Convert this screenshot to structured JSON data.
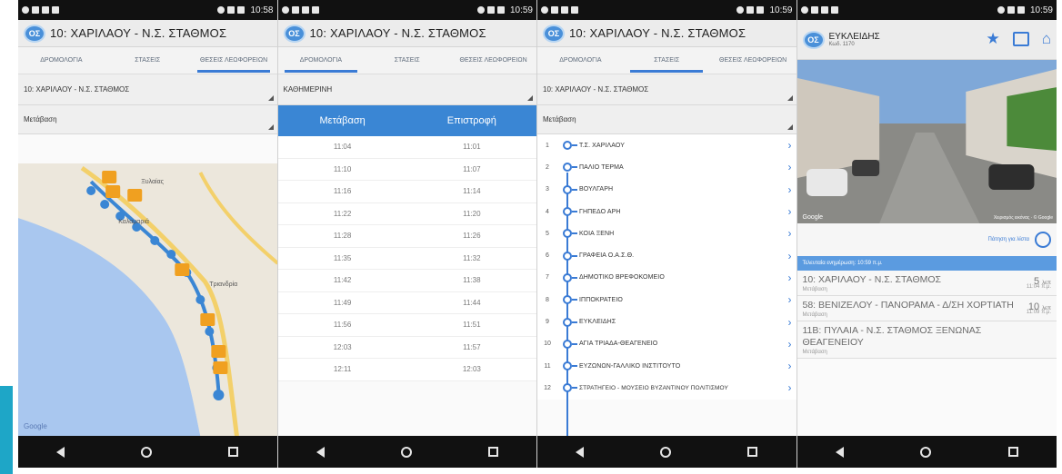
{
  "status_bar": {
    "time_1": "10:58",
    "time_2": "10:59",
    "time_3": "10:59",
    "time_4": "10:59"
  },
  "app": {
    "title": "10: ΧΑΡΙΛΑΟΥ - Ν.Σ. ΣΤΑΘΜΟΣ",
    "logo_text": "OΣ"
  },
  "tabs": [
    "ΔΡΟΜΟΛΟΓΙΑ",
    "ΣΤΑΣΕΙΣ",
    "ΘΕΣΕΙΣ ΛΕΩΦΟΡΕΙΩΝ"
  ],
  "screen1": {
    "route_select": "10: ΧΑΡΙΛΑΟΥ - Ν.Σ. ΣΤΑΘΜΟΣ",
    "direction_select": "Μετάβαση",
    "map_labels": [
      "Ξυλαίας",
      "Καλαμαριά",
      "Τριανδρία"
    ],
    "map_credit": "Google"
  },
  "screen2": {
    "day_select": "ΚΑΘΗΜΕΡΙΝΗ",
    "col_out": "Μετάβαση",
    "col_back": "Επιστροφή",
    "rows": [
      [
        "11:04",
        "11:01"
      ],
      [
        "11:10",
        "11:07"
      ],
      [
        "11:16",
        "11:14"
      ],
      [
        "11:22",
        "11:20"
      ],
      [
        "11:28",
        "11:26"
      ],
      [
        "11:35",
        "11:32"
      ],
      [
        "11:42",
        "11:38"
      ],
      [
        "11:49",
        "11:44"
      ],
      [
        "11:56",
        "11:51"
      ],
      [
        "12:03",
        "11:57"
      ],
      [
        "12:11",
        "12:03"
      ]
    ]
  },
  "screen3": {
    "route_select": "10: ΧΑΡΙΛΑΟΥ - Ν.Σ. ΣΤΑΘΜΟΣ",
    "direction_select": "Μετάβαση",
    "stops": [
      {
        "n": "1",
        "name": "Τ.Σ. ΧΑΡΙΛΑΟΥ"
      },
      {
        "n": "2",
        "name": "ΠΑΛΙΟ ΤΕΡΜΑ"
      },
      {
        "n": "3",
        "name": "ΒΟΥΛΓΑΡΗ"
      },
      {
        "n": "4",
        "name": "ΓΗΠΕΔΟ ΑΡΗ"
      },
      {
        "n": "5",
        "name": "ΚΟΙΑ ΞΕΝΗ"
      },
      {
        "n": "6",
        "name": "ΓΡΑΦΕΙΑ Ο.Α.Σ.Θ."
      },
      {
        "n": "7",
        "name": "ΔΗΜΟΤΙΚΟ ΒΡΕΦΟΚΟΜΕΙΟ"
      },
      {
        "n": "8",
        "name": "ΙΠΠΟΚΡΑΤΕΙΟ"
      },
      {
        "n": "9",
        "name": "ΕΥΚΛΕΙΔΗΣ"
      },
      {
        "n": "10",
        "name": "ΑΓΙΑ ΤΡΙΑΔΑ-ΘΕΑΓΕΝΕΙΟ"
      },
      {
        "n": "11",
        "name": "ΕΥΖΩΝΩΝ-ΓΑΛΛΙΚΟ ΙΝΣΤΙΤΟΥΤΟ"
      },
      {
        "n": "12",
        "name": "ΣΤΡΑΤΗΓΕΙΟ - ΜΟΥΣΕΙΟ ΒΥΖΑΝΤΙΝΟΥ ΠΟΛΙΤΙΣΜΟΥ"
      }
    ]
  },
  "screen4": {
    "stop_name": "ΕΥΚΛΕΙΔΗΣ",
    "stop_code": "Κωδ. 1170",
    "sv_brand": "Google",
    "sv_credit": "Χειρισμός εικόνας · © Google",
    "more_link": "Πάτηση για λίστα",
    "arrivals_bar": "Τελευταία ενημέρωση: 10:59 π.μ.",
    "arrivals": [
      {
        "route": "10: ΧΑΡΙΛΑΟΥ - Ν.Σ. ΣΤΑΘΜΟΣ",
        "dir": "Μετάβαση",
        "min": "5",
        "unit": "λεπ",
        "time": "11:04 π.μ."
      },
      {
        "route": "58: ΒΕΝΙΖΕΛΟΥ - ΠΑΝΟΡΑΜΑ - Δ/ΣΗ ΧΟΡΤΙΑΤΗ",
        "dir": "Μετάβαση",
        "min": "10",
        "unit": "λεπ",
        "time": "11:09 π.μ."
      },
      {
        "route": "11Β: ΠΥΛΑΙΑ - Ν.Σ. ΣΤΑΘΜΟΣ ΞΕΝΩΝΑΣ ΘΕΑΓΕΝΕΙΟΥ",
        "dir": "Μετάβαση",
        "min": "",
        "unit": "",
        "time": ""
      }
    ]
  },
  "colors": {
    "accent": "#3a7bd5",
    "header_blue": "#3a86d4",
    "bus_orange": "#f0a020"
  }
}
